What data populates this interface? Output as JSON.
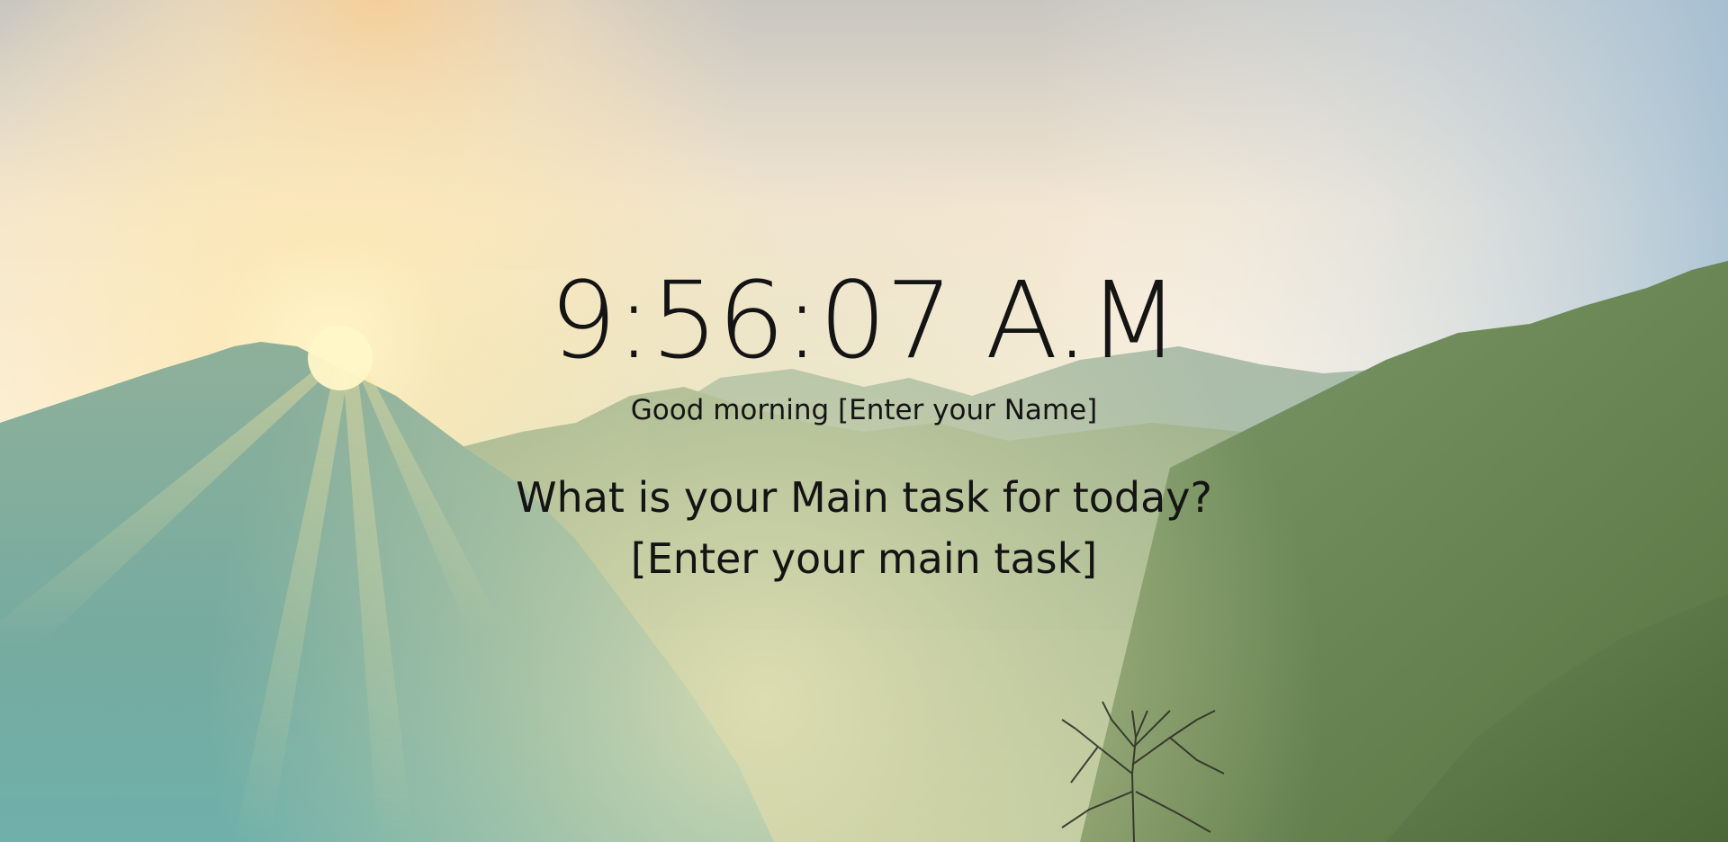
{
  "clock": {
    "time": "9:56:07 A.M"
  },
  "greeting": {
    "prefix": "Good morning",
    "name": "[Enter your Name]"
  },
  "focus": {
    "question": "What is your Main task for today?",
    "task": "[Enter your main task]"
  },
  "background": {
    "subject": "mountain sunrise landscape with tree",
    "colors": {
      "sky_top": "#c9c8c2",
      "sky_glow": "#fbf0d8",
      "sky_right": "#a9c4d6",
      "sun": "#fff3b8",
      "ridge_far": "#8fae9e",
      "ridge_mid": "#7fa792",
      "ridge_near_left": "#6fa8a0",
      "ridge_near_right": "#5f8452",
      "haze": "#d8d8ae"
    }
  }
}
